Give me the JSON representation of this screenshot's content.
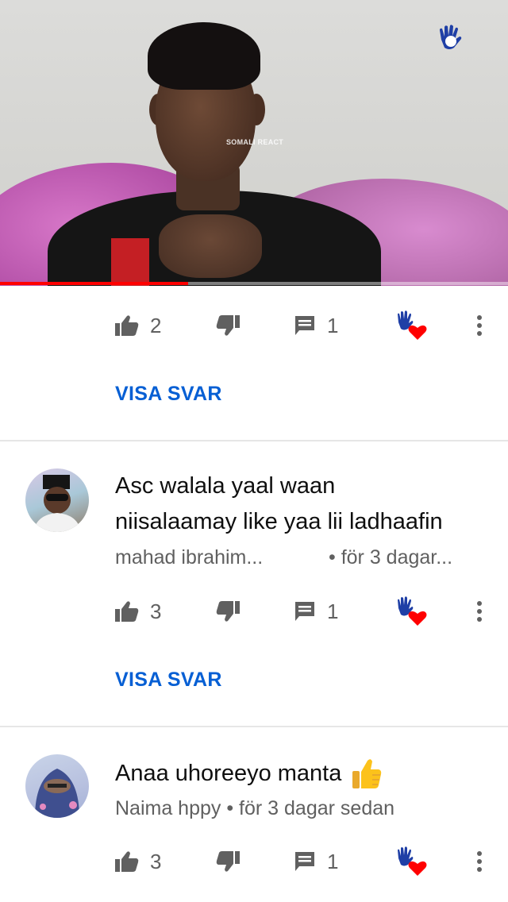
{
  "video": {
    "watermark": "SOMALI REACT",
    "progress_percent": 37,
    "logo_text": "SOMALI REACT"
  },
  "comments": [
    {
      "likes": "2",
      "replies": "1",
      "reply_button": "VISA SVAR"
    },
    {
      "text_line1": "Asc walala yaal waan",
      "text_line2": "niisalaamay like yaa lii ladhaafin",
      "author": "mahad ibrahim...",
      "time": "• för 3 dagar...",
      "likes": "3",
      "replies": "1",
      "reply_button": "VISA SVAR"
    },
    {
      "text": "Anaa uhoreeyo manta",
      "author": "Naima hppy",
      "time": "• för 3 dagar sedan",
      "likes": "3",
      "replies": "1"
    }
  ],
  "colors": {
    "accent": "#065fd4",
    "progress": "#ff0000",
    "icon": "#606060",
    "heart": "#ff0000"
  },
  "icons": [
    "thumbs-up-icon",
    "thumbs-down-icon",
    "comment-icon",
    "creator-heart-icon",
    "more-vert-icon",
    "thumbs-up-emoji"
  ]
}
